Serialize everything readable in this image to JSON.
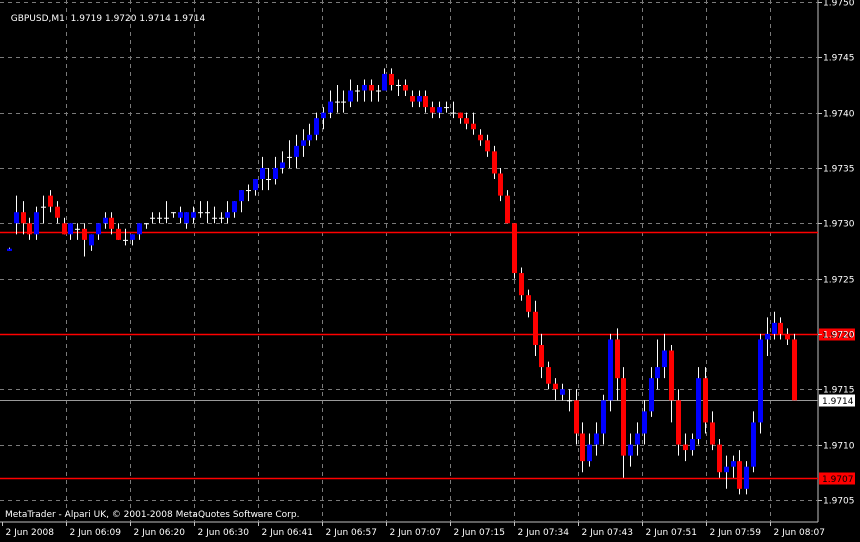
{
  "header": {
    "symbol_tf": "GBPUSD,M1",
    "ohlc": "1.9719 1.9720 1.9714 1.9714"
  },
  "footer": {
    "copyright": "MetaTrader - Alpari UK, © 2001-2008 MetaQuotes Software Corp."
  },
  "colors": {
    "background": "#000000",
    "grid": "#7a7a7a",
    "axis_text": "#ffffff",
    "bull": "#0000ff",
    "bear": "#ff0000",
    "doji": "#ffffff",
    "hline": "#ff0000",
    "bid_line": "#9a9a9a"
  },
  "chart_data": {
    "type": "candlestick",
    "y_axis": {
      "range": [
        1.9703,
        1.975
      ],
      "ticks": [
        "1.9750",
        "1.9745",
        "1.9740",
        "1.9735",
        "1.9730",
        "1.9725",
        "1.9720",
        "1.9715",
        "1.9710",
        "1.9705"
      ]
    },
    "x_axis": {
      "labels": [
        "2 Jun 2008",
        "2 Jun 06:09",
        "2 Jun 06:20",
        "2 Jun 06:30",
        "2 Jun 06:41",
        "2 Jun 06:57",
        "2 Jun 07:07",
        "2 Jun 07:15",
        "2 Jun 07:34",
        "2 Jun 07:43",
        "2 Jun 07:51",
        "2 Jun 07:59",
        "2 Jun 08:07"
      ]
    },
    "horizontal_lines": [
      {
        "price": 1.97292,
        "label": ""
      },
      {
        "price": 1.972,
        "label": "1.9720"
      },
      {
        "price": 1.9707,
        "label": "1.9707"
      }
    ],
    "bid_line": {
      "price": 1.9714,
      "label": "1.9714"
    },
    "grid": true,
    "candles": [
      [
        1.97275,
        1.97278,
        1.97275,
        1.97277
      ],
      [
        1.973,
        1.97325,
        1.9729,
        1.9731
      ],
      [
        1.9731,
        1.9732,
        1.9729,
        1.973
      ],
      [
        1.973,
        1.97305,
        1.97285,
        1.9729
      ],
      [
        1.9729,
        1.97315,
        1.97285,
        1.9731
      ],
      [
        1.97315,
        1.97325,
        1.973,
        1.97315
      ],
      [
        1.97325,
        1.9733,
        1.9731,
        1.97315
      ],
      [
        1.97315,
        1.9732,
        1.973,
        1.97305
      ],
      [
        1.973,
        1.97305,
        1.9729,
        1.9729
      ],
      [
        1.9729,
        1.973,
        1.97285,
        1.973
      ],
      [
        1.97295,
        1.973,
        1.97285,
        1.97295
      ],
      [
        1.97295,
        1.973,
        1.9727,
        1.97285
      ],
      [
        1.9728,
        1.9729,
        1.97275,
        1.9729
      ],
      [
        1.9729,
        1.973,
        1.97285,
        1.973
      ],
      [
        1.973,
        1.9731,
        1.97295,
        1.97305
      ],
      [
        1.97305,
        1.9731,
        1.9729,
        1.97295
      ],
      [
        1.97295,
        1.973,
        1.97285,
        1.97285
      ],
      [
        1.97285,
        1.97295,
        1.9728,
        1.97285
      ],
      [
        1.97285,
        1.9729,
        1.9728,
        1.9729
      ],
      [
        1.9729,
        1.973,
        1.97285,
        1.973
      ],
      [
        1.973,
        1.973,
        1.97295,
        1.973
      ],
      [
        1.97305,
        1.9731,
        1.973,
        1.97305
      ],
      [
        1.97305,
        1.9731,
        1.973,
        1.97305
      ],
      [
        1.97305,
        1.9732,
        1.973,
        1.97305
      ],
      [
        1.9731,
        1.9731,
        1.97305,
        1.9731
      ],
      [
        1.97305,
        1.97315,
        1.973,
        1.9731
      ],
      [
        1.973,
        1.9731,
        1.97295,
        1.9731
      ],
      [
        1.97305,
        1.97315,
        1.973,
        1.9731
      ],
      [
        1.9731,
        1.9732,
        1.97305,
        1.9731
      ],
      [
        1.9731,
        1.9732,
        1.973,
        1.9731
      ],
      [
        1.97305,
        1.97315,
        1.973,
        1.97305
      ],
      [
        1.97305,
        1.9731,
        1.973,
        1.97305
      ],
      [
        1.97305,
        1.9732,
        1.973,
        1.9731
      ],
      [
        1.9731,
        1.9732,
        1.97305,
        1.9732
      ],
      [
        1.9732,
        1.9733,
        1.9731,
        1.9733
      ],
      [
        1.9733,
        1.97335,
        1.9732,
        1.9733
      ],
      [
        1.9733,
        1.9734,
        1.97325,
        1.9734
      ],
      [
        1.9734,
        1.9736,
        1.9733,
        1.9735
      ],
      [
        1.9734,
        1.9735,
        1.9733,
        1.9734
      ],
      [
        1.9734,
        1.9736,
        1.97335,
        1.9735
      ],
      [
        1.9735,
        1.97365,
        1.97345,
        1.97355
      ],
      [
        1.9736,
        1.97375,
        1.9735,
        1.9736
      ],
      [
        1.9736,
        1.9738,
        1.9735,
        1.9737
      ],
      [
        1.9737,
        1.97385,
        1.9736,
        1.97375
      ],
      [
        1.97375,
        1.9739,
        1.9737,
        1.9738
      ],
      [
        1.9738,
        1.974,
        1.97375,
        1.97395
      ],
      [
        1.97395,
        1.97405,
        1.97385,
        1.974
      ],
      [
        1.974,
        1.9742,
        1.97395,
        1.9741
      ],
      [
        1.9741,
        1.97425,
        1.974,
        1.9741
      ],
      [
        1.9741,
        1.9742,
        1.974,
        1.9741
      ],
      [
        1.9741,
        1.9743,
        1.97405,
        1.9742
      ],
      [
        1.9742,
        1.97425,
        1.9741,
        1.9742
      ],
      [
        1.9742,
        1.9743,
        1.9741,
        1.97425
      ],
      [
        1.97425,
        1.9743,
        1.9741,
        1.9742
      ],
      [
        1.9742,
        1.97425,
        1.9741,
        1.9742
      ],
      [
        1.9742,
        1.9744,
        1.9742,
        1.97435
      ],
      [
        1.97435,
        1.9744,
        1.9742,
        1.97425
      ],
      [
        1.97425,
        1.9743,
        1.97415,
        1.97425
      ],
      [
        1.97425,
        1.9743,
        1.97415,
        1.9742
      ],
      [
        1.97415,
        1.9742,
        1.97405,
        1.9741
      ],
      [
        1.9741,
        1.9742,
        1.97405,
        1.97415
      ],
      [
        1.97415,
        1.9742,
        1.974,
        1.97405
      ],
      [
        1.97405,
        1.9741,
        1.97395,
        1.974
      ],
      [
        1.974,
        1.9741,
        1.97395,
        1.97405
      ],
      [
        1.97405,
        1.9741,
        1.974,
        1.97405
      ],
      [
        1.974,
        1.9741,
        1.97395,
        1.974
      ],
      [
        1.974,
        1.974,
        1.9739,
        1.97395
      ],
      [
        1.97395,
        1.974,
        1.97385,
        1.9739
      ],
      [
        1.9739,
        1.974,
        1.9738,
        1.97385
      ],
      [
        1.9738,
        1.97385,
        1.9737,
        1.97375
      ],
      [
        1.97375,
        1.9738,
        1.9736,
        1.97365
      ],
      [
        1.97365,
        1.9737,
        1.9734,
        1.97345
      ],
      [
        1.97345,
        1.9735,
        1.9732,
        1.97325
      ],
      [
        1.97325,
        1.9733,
        1.973,
        1.973
      ],
      [
        1.973,
        1.973,
        1.9725,
        1.97255
      ],
      [
        1.97255,
        1.9726,
        1.9723,
        1.97235
      ],
      [
        1.97235,
        1.9724,
        1.97215,
        1.9722
      ],
      [
        1.9722,
        1.9723,
        1.9718,
        1.9719
      ],
      [
        1.9719,
        1.972,
        1.9716,
        1.9717
      ],
      [
        1.9717,
        1.97175,
        1.9715,
        1.97155
      ],
      [
        1.97155,
        1.9716,
        1.9714,
        1.9715
      ],
      [
        1.97145,
        1.97155,
        1.9714,
        1.9715
      ],
      [
        1.9714,
        1.9715,
        1.9713,
        1.9714
      ],
      [
        1.9714,
        1.9715,
        1.971,
        1.9711
      ],
      [
        1.9711,
        1.9712,
        1.97075,
        1.97085
      ],
      [
        1.97085,
        1.9711,
        1.9708,
        1.971
      ],
      [
        1.971,
        1.9712,
        1.9709,
        1.9711
      ],
      [
        1.9711,
        1.97145,
        1.971,
        1.9714
      ],
      [
        1.9714,
        1.972,
        1.9713,
        1.97195
      ],
      [
        1.97195,
        1.97205,
        1.9714,
        1.9716
      ],
      [
        1.9716,
        1.9717,
        1.9707,
        1.9709
      ],
      [
        1.9709,
        1.9711,
        1.9708,
        1.971
      ],
      [
        1.971,
        1.9712,
        1.9709,
        1.9711
      ],
      [
        1.9711,
        1.9714,
        1.971,
        1.9713
      ],
      [
        1.9713,
        1.9717,
        1.97125,
        1.9716
      ],
      [
        1.9716,
        1.97195,
        1.9715,
        1.9717
      ],
      [
        1.9717,
        1.972,
        1.9716,
        1.97185
      ],
      [
        1.97185,
        1.9719,
        1.9712,
        1.9714
      ],
      [
        1.9714,
        1.9715,
        1.9709,
        1.971
      ],
      [
        1.971,
        1.9711,
        1.97085,
        1.97095
      ],
      [
        1.97095,
        1.9711,
        1.9709,
        1.97105
      ],
      [
        1.97105,
        1.9717,
        1.971,
        1.9716
      ],
      [
        1.9716,
        1.9717,
        1.9711,
        1.9712
      ],
      [
        1.9712,
        1.9713,
        1.97095,
        1.971
      ],
      [
        1.971,
        1.97105,
        1.9707,
        1.97075
      ],
      [
        1.97075,
        1.9709,
        1.9706,
        1.9708
      ],
      [
        1.9708,
        1.9709,
        1.9707,
        1.97085
      ],
      [
        1.97085,
        1.97095,
        1.97055,
        1.9706
      ],
      [
        1.9706,
        1.97085,
        1.97055,
        1.9708
      ],
      [
        1.9708,
        1.9713,
        1.97075,
        1.9712
      ],
      [
        1.9712,
        1.972,
        1.9711,
        1.97195
      ],
      [
        1.97195,
        1.97215,
        1.9718,
        1.972
      ],
      [
        1.972,
        1.9722,
        1.97195,
        1.9721
      ],
      [
        1.9721,
        1.97215,
        1.97195,
        1.972
      ],
      [
        1.972,
        1.97205,
        1.9719,
        1.97195
      ],
      [
        1.97195,
        1.972,
        1.9714,
        1.9714
      ]
    ]
  }
}
